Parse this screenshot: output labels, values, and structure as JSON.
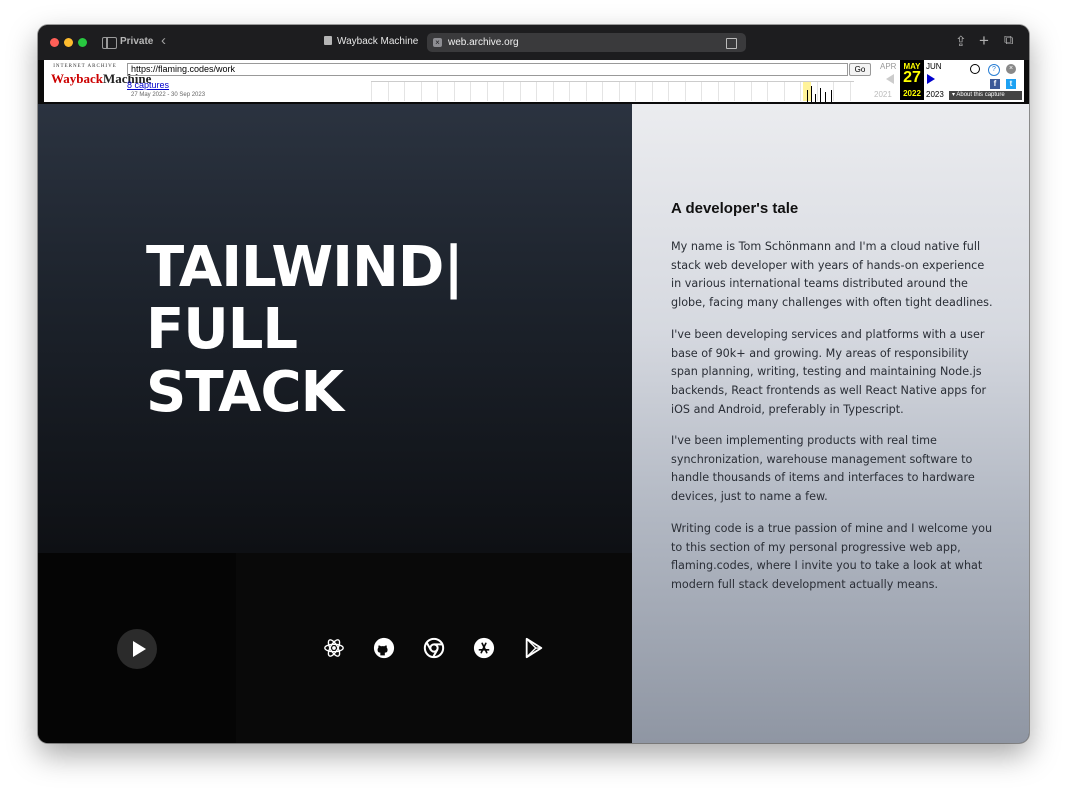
{
  "browser": {
    "private_label": "Private",
    "tab_title": "Wayback Machine",
    "address": "web.archive.org"
  },
  "wayback": {
    "logo_top": "INTERNET ARCHIVE",
    "logo_main_a": "Wayback",
    "logo_main_b": "Machine",
    "url_value": "https://flaming.codes/work",
    "go_label": "Go",
    "captures_link": "8 captures",
    "captures_range": "27 May 2022 - 30 Sep 2023",
    "prev_month": "APR",
    "current_month": "MAY",
    "current_day": "27",
    "current_year": "2022",
    "next_month": "JUN",
    "prev_year": "2021",
    "next_year": "2023",
    "about_label": "About this capture",
    "help_glyph": "?",
    "close_glyph": "×",
    "facebook_glyph": "f",
    "twitter_glyph": "t"
  },
  "hero": {
    "line1": "TAILWIND|",
    "line2": "FULL",
    "line3": "STACK"
  },
  "tech_icons": [
    "react-icon",
    "github-icon",
    "chrome-icon",
    "app-store-icon",
    "google-play-icon"
  ],
  "article": {
    "heading": "A developer's tale",
    "p1": "My name is Tom Schönmann and I'm a cloud native full stack web developer with years of hands-on experience in various international teams distributed around the globe, facing many challenges with often tight deadlines.",
    "p2": "I've been developing services and platforms with a user base of 90k+ and growing. My areas of responsibility span planning, writing, testing and maintaining Node.js backends, React frontends as well React Native apps for iOS and Android, preferably in Typescript.",
    "p3": "I've been implementing products with real time synchronization, warehouse management software to handle thousands of items and interfaces to hardware devices, just to name a few.",
    "p4": "Writing code is a true passion of mine and I welcome you to this section of my personal progressive web app, flaming.codes, where I invite you to take a look at what modern full stack development actually means."
  }
}
